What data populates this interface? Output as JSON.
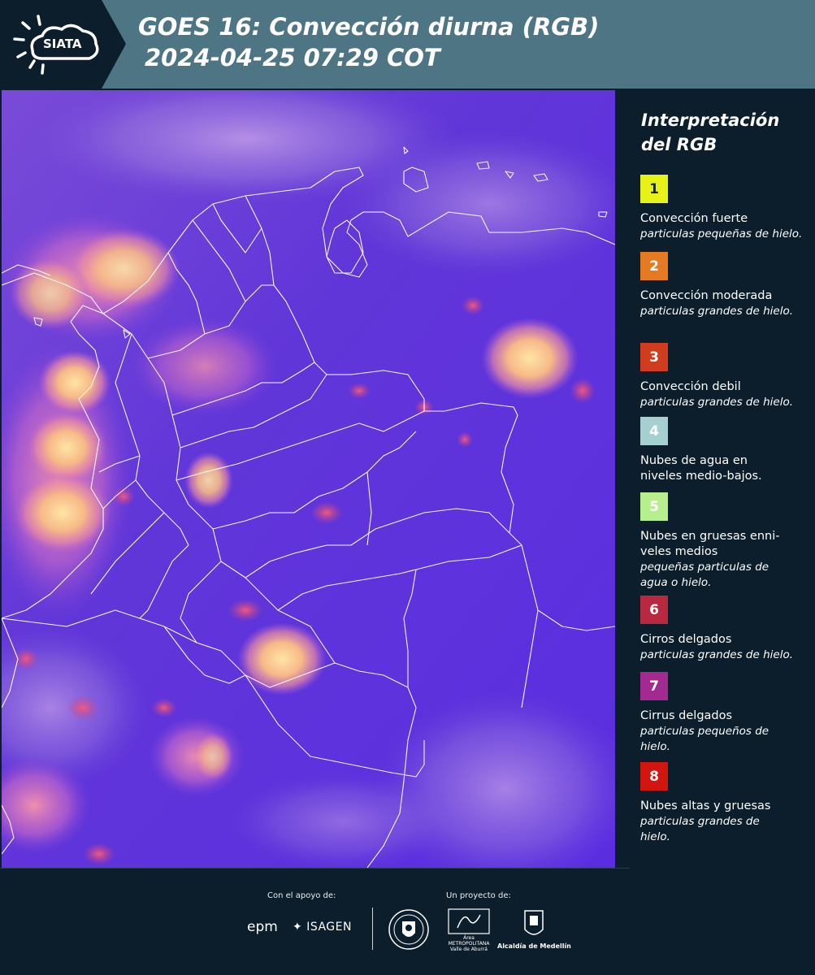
{
  "header": {
    "logo_text": "SIATA",
    "title_line1": "GOES 16: Convección diurna (RGB)",
    "title_line2": "2024-04-25 07:29 COT"
  },
  "map": {
    "description_colors": {
      "background": "#5a34d8",
      "convection": "#f7c28a",
      "borders": "#ffffff"
    }
  },
  "legend": {
    "title_line1": "Interpretación",
    "title_line2": "del RGB",
    "items": [
      {
        "number": "1",
        "color": "#e6f218",
        "title": "Convección fuerte",
        "subtitle": "particulas pequeñas de hielo."
      },
      {
        "number": "2",
        "color": "#e57a23",
        "title": "Convección moderada",
        "subtitle": "particulas grandes de hielo."
      },
      {
        "number": "3",
        "color": "#d23c1e",
        "title": "Convección debil",
        "subtitle": "particulas grandes de hielo."
      },
      {
        "number": "4",
        "color": "#a5d0cf",
        "title": "Nubes de agua en niveles medio-bajos.",
        "subtitle": ""
      },
      {
        "number": "5",
        "color": "#b7ee8e",
        "title": "Nubes en gruesas enni-veles medios",
        "subtitle": "pequeñas particulas de agua o hielo."
      },
      {
        "number": "6",
        "color": "#b8283f",
        "title": "Cirros delgados",
        "subtitle": "particulas grandes de hielo."
      },
      {
        "number": "7",
        "color": "#a22a91",
        "title": "Cirrus delgados",
        "subtitle": "particulas pequeños de hielo."
      },
      {
        "number": "8",
        "color": "#d2150f",
        "title": "Nubes altas y gruesas",
        "subtitle": "particulas grandes de hielo."
      }
    ]
  },
  "footer": {
    "support_label": "Con el apoyo de:",
    "project_label": "Un proyecto de:",
    "epm": "epm",
    "isagen": "ISAGEN",
    "area_metro": "Área METROPOLITANA Valle de Aburrá",
    "alcaldia": "Alcaldía de Medellín"
  }
}
